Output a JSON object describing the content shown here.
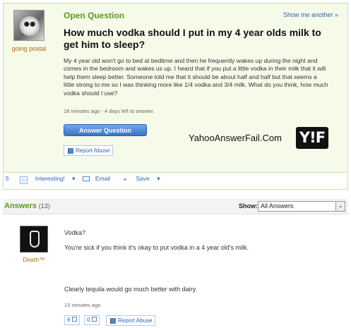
{
  "question": {
    "label": "Open Question",
    "show_more": "Show me another »",
    "username": "going postal",
    "title": "How much vodka should I put in my 4 year olds milk to get him to sleep?",
    "body": "My 4 year old won't go to bed at bedtime and then he frequently wakes up during the night and comes in the bedroom and wakes us up. I heard that if you put a little vodka in their milk that it will help them sleep better. Someone told me that it should be about half and half but that seems a little strong to me so I was thinking more like 1/4 vodka and 3/4 milk. What do you think, how much vodka should I use?",
    "meta": "18 minutes ago - 4 days left to answer.",
    "answer_button": "Answer Question",
    "report_abuse": "Report Abuse",
    "watermark": "YahooAnswerFail.Com",
    "logo": "Y!F",
    "actions": {
      "interesting_count": "5",
      "interesting": "Interesting!",
      "email": "Email",
      "save": "Save"
    }
  },
  "answers_section": {
    "title": "Answers",
    "count": "(13)",
    "show_label": "Show:",
    "filter_value": "All Answers"
  },
  "answer": {
    "username": "Death™",
    "line1": "Vodka?",
    "line2": "You're sick if you think it's okay to put vodka in a 4 year old's milk.",
    "line3": "Clearly tequila would go much better with dairy.",
    "meta": "13 minutes ago",
    "thumbs_up": "6",
    "thumbs_down": "0",
    "report_abuse": "Report Abuse"
  },
  "colors": {
    "accent_green": "#5b9b1e",
    "link_blue": "#2b65b5",
    "username_orange": "#a86d12"
  }
}
